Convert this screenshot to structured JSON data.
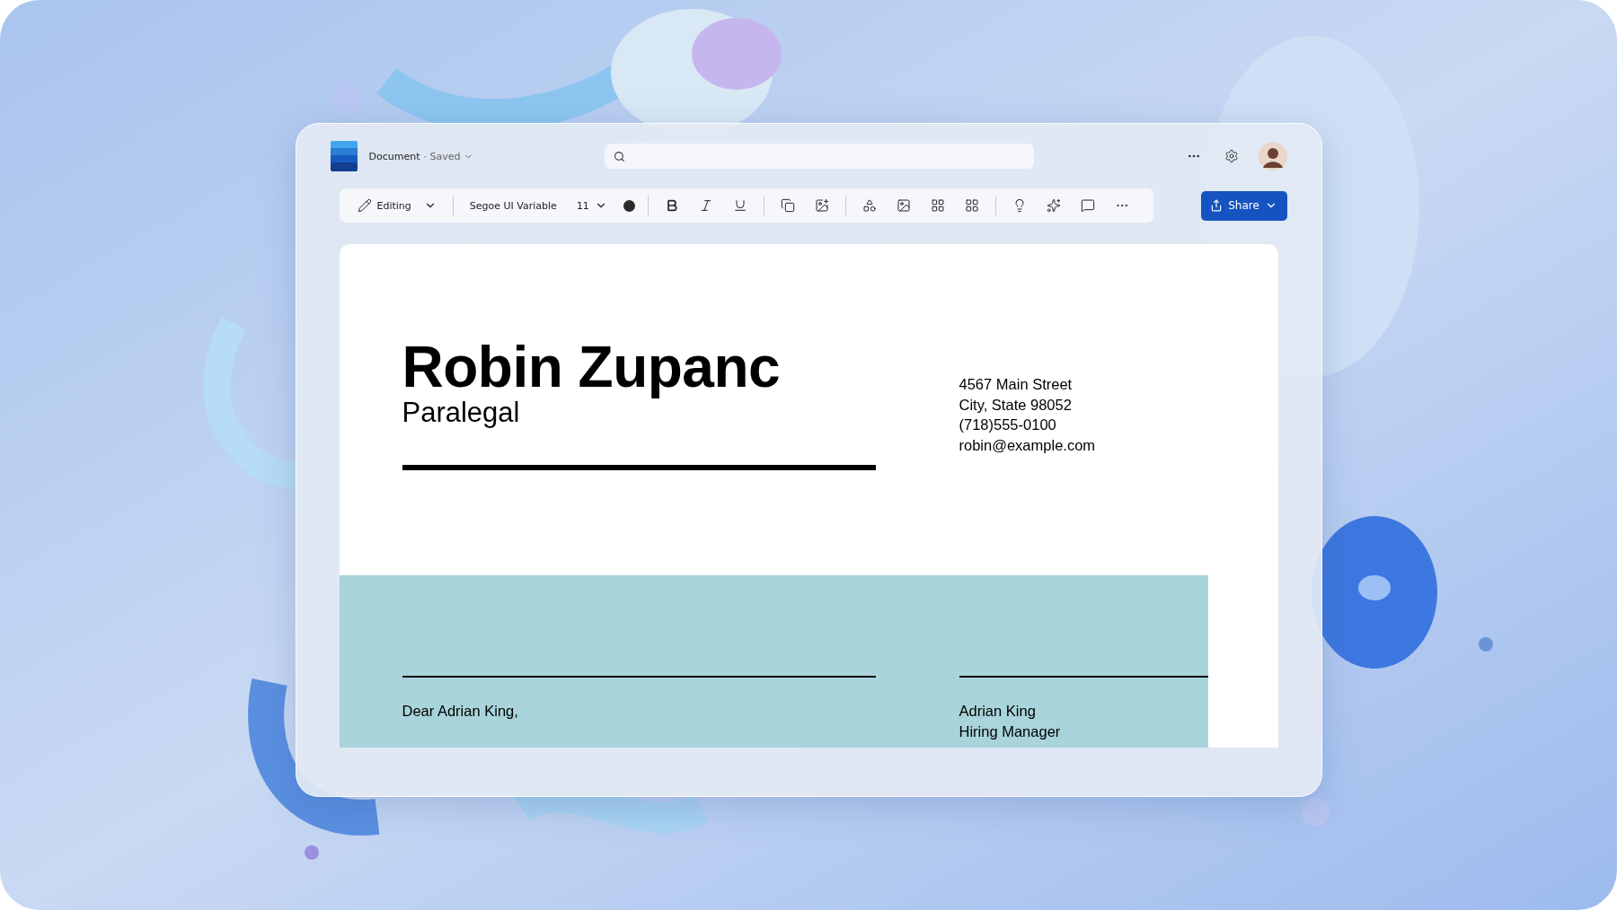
{
  "app": {
    "document_title": "Document",
    "save_status": "· Saved"
  },
  "toolbar": {
    "mode": "Editing",
    "font": "Segoe UI Variable",
    "font_size": "11",
    "share": "Share"
  },
  "document": {
    "name": "Robin Zupanc",
    "role": "Paralegal",
    "contact": [
      "4567 Main Street",
      "City, State 98052",
      "(718)555-0100",
      "robin@example.com"
    ],
    "salutation": "Dear Adrian King,",
    "recipient": [
      "Adrian King",
      "Hiring Manager"
    ]
  }
}
